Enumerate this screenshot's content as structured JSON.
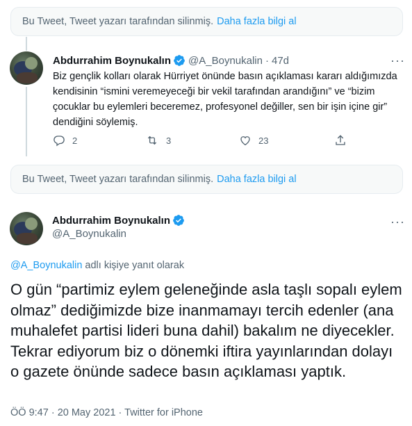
{
  "deleted_notice": {
    "text": "Bu Tweet, Tweet yazarı tarafından silinmiş.",
    "link": "Daha fazla bilgi al"
  },
  "tweet1": {
    "display_name": "Abdurrahim Boynukalın",
    "handle": "@A_Boynukalin",
    "separator": "·",
    "time": "47d",
    "more": "···",
    "text": "Biz gençlik kolları olarak Hürriyet önünde basın açıklaması kararı aldığımızda kendisinin “ismini veremeyeceği bir vekil tarafından arandığını” ve “bizim çocuklar bu eylemleri beceremez, profesyonel değiller, sen bir işin içine gir” dendiğini söylemiş.",
    "replies": "2",
    "retweets": "3",
    "likes": "23"
  },
  "tweet2": {
    "display_name": "Abdurrahim Boynukalın",
    "handle": "@A_Boynukalin",
    "more": "···",
    "reply_mention": "@A_Boynukalin",
    "reply_suffix": "adlı kişiye yanıt olarak",
    "text": "O gün “partimiz eylem geleneğinde asla taşlı sopalı eylem olmaz” dediğimizde bize inanmamayı tercih edenler (ana muhalefet partisi lideri buna dahil) bakalım ne diyecekler. Tekrar ediyorum biz o dönemki iftira yayınlarından dolayı o gazete önünde sadece basın açıklaması yaptık.",
    "meta": "ÖÖ 9:47 · 20 May 2021 · Twitter for iPhone"
  },
  "colors": {
    "accent": "#1d9bf0",
    "secondary_text": "#536471",
    "primary_text": "#0f1419"
  }
}
